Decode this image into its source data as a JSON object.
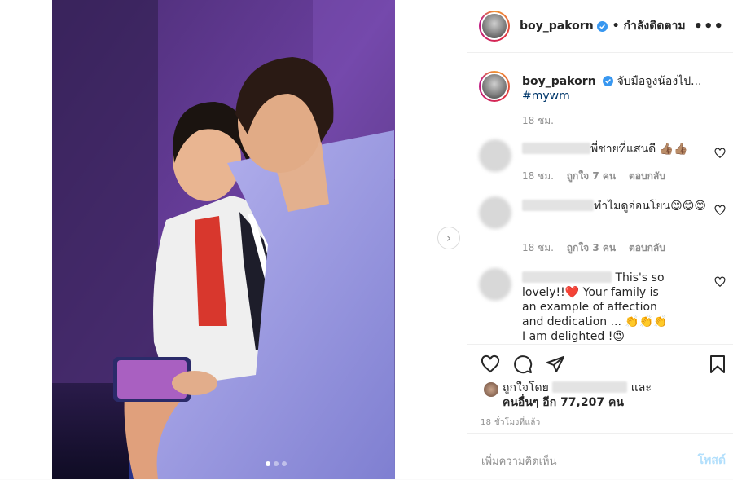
{
  "post": {
    "username": "boy_pakorn",
    "follow_status": "• กำลังติดตาม",
    "more_label": "•••",
    "caption_text": "จับมือจูงน้องไป...",
    "hashtag": "#mywm",
    "caption_time": "18 ชม.",
    "next_arrow": "›"
  },
  "comments": [
    {
      "text": "พี่ชายที่แสนดี 👍🏽👍🏽",
      "time": "18 ชม.",
      "likes": "ถูกใจ 7 คน",
      "reply": "ตอบกลับ"
    },
    {
      "text": "ทำไมดูอ่อนโยน😊😊😊",
      "time": "18 ชม.",
      "likes": "ถูกใจ 3 คน",
      "reply": "ตอบกลับ"
    },
    {
      "text": "This's so lovely!!❤️ Your family is an example of affection and dedication ... 👏👏👏 I am delighted !😍"
    }
  ],
  "likes": {
    "line1_prefix": "ถูกใจโดย",
    "line1_suffix": "และ",
    "line2": "คนอื่นๆ อีก 77,207 คน"
  },
  "post_time": "18 ชั่วโมงที่แล้ว",
  "add_comment": {
    "placeholder": "เพิ่มความคิดเห็น",
    "post_label": "โพสต์"
  },
  "colors": {
    "verified": "#3897f0",
    "link": "#00376b",
    "muted": "#8e8e8e",
    "post_disabled": "#b2dffc"
  }
}
